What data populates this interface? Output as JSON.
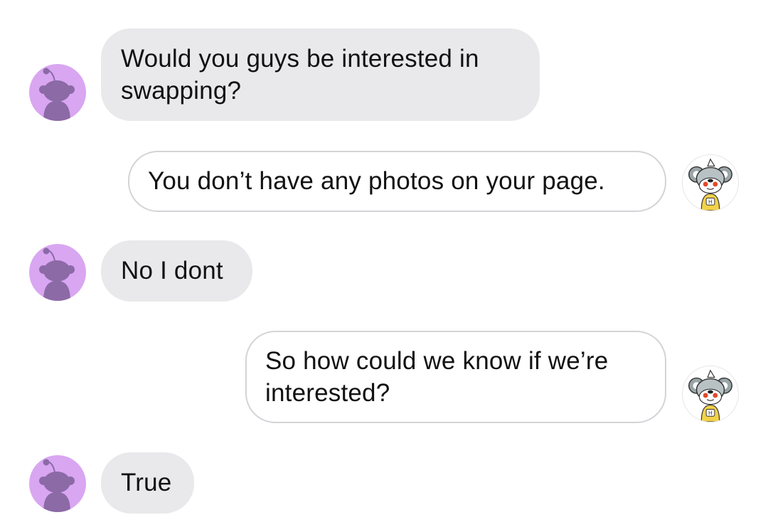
{
  "conversation": {
    "messages": [
      {
        "sender": "them",
        "text": "Would you guys be interested in swapping?"
      },
      {
        "sender": "me",
        "text": "You don’t have any photos on your page."
      },
      {
        "sender": "them",
        "text": "No I dont"
      },
      {
        "sender": "me",
        "text": "So how could we know if we’re interested?"
      },
      {
        "sender": "them",
        "text": "True"
      }
    ]
  },
  "icons": {
    "them_avatar": "snoo-silhouette-icon",
    "me_avatar": "koala-snoo-icon"
  },
  "colors": {
    "incoming_bubble": "#e9e9eb",
    "outgoing_border": "#d4d4d8",
    "them_avatar_bg": "#d9a6f2",
    "snoo_silhouette": "#8b6aa6"
  }
}
